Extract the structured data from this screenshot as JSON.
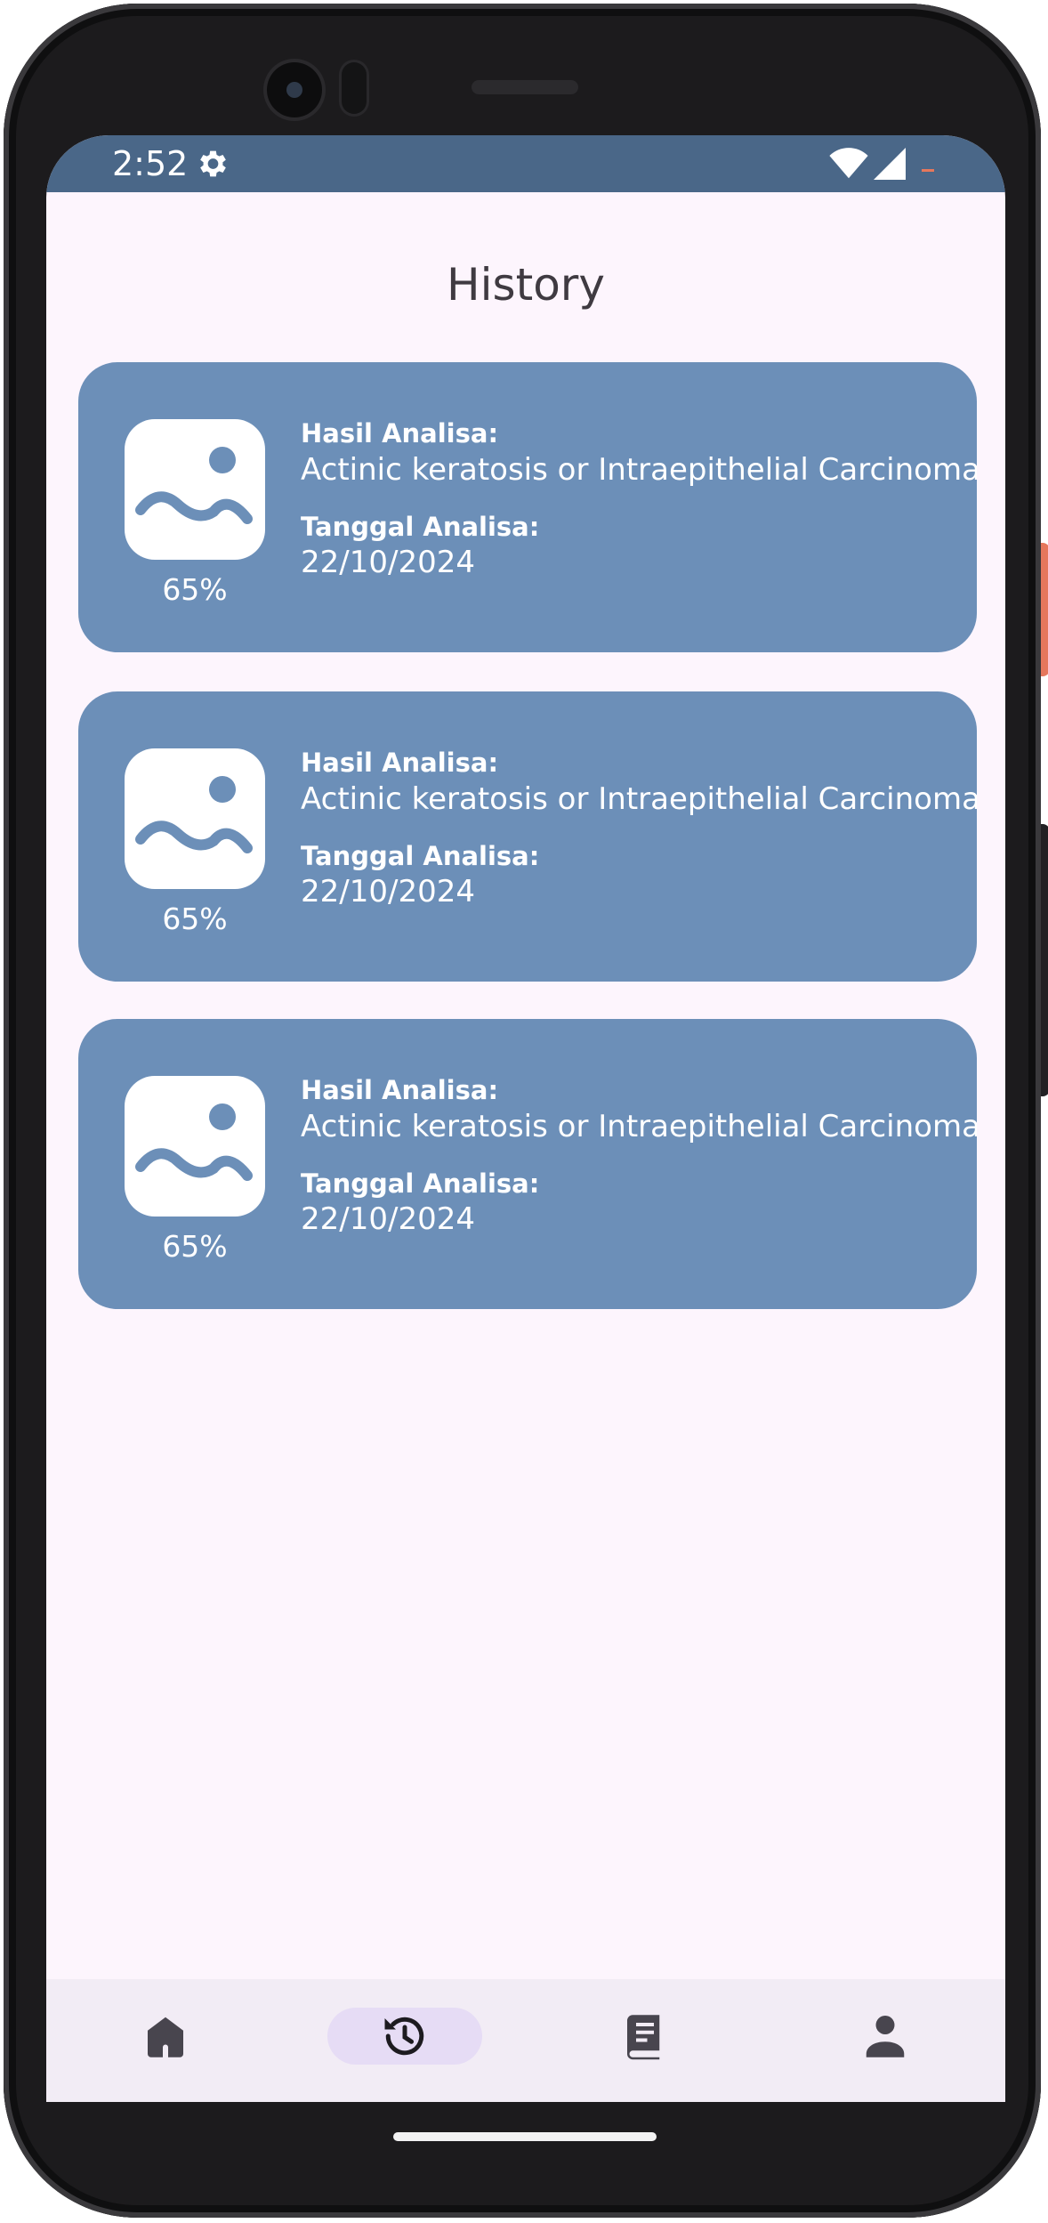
{
  "status_bar": {
    "time": "2:52",
    "icons": [
      "gear-icon",
      "wifi-icon",
      "cell-signal-icon",
      "battery-icon"
    ]
  },
  "page": {
    "title": "History"
  },
  "history": [
    {
      "confidence": "65%",
      "result_label": "Hasil Analisa:",
      "result_value": "Actinic keratosis or Intraepithelial Carcinoma",
      "date_label": "Tanggal Analisa:",
      "date_value": "22/10/2024",
      "thumbnail_icon": "image-placeholder-icon"
    },
    {
      "confidence": "65%",
      "result_label": "Hasil Analisa:",
      "result_value": "Actinic keratosis or Intraepithelial Carcinoma",
      "date_label": "Tanggal Analisa:",
      "date_value": "22/10/2024",
      "thumbnail_icon": "image-placeholder-icon"
    },
    {
      "confidence": "65%",
      "result_label": "Hasil Analisa:",
      "result_value": "Actinic keratosis or Intraepithelial Carcinoma",
      "date_label": "Tanggal Analisa:",
      "date_value": "22/10/2024",
      "thumbnail_icon": "image-placeholder-icon"
    }
  ],
  "bottom_nav": {
    "items": [
      {
        "icon": "home-icon",
        "active": false
      },
      {
        "icon": "history-icon",
        "active": true
      },
      {
        "icon": "book-icon",
        "active": false
      },
      {
        "icon": "person-icon",
        "active": false
      }
    ]
  },
  "colors": {
    "status_bar": "#4a6788",
    "card_background": "#6c8fb8",
    "screen_background": "#fdf5fd",
    "nav_background": "#f2ecf5",
    "nav_active_indicator": "#e6dcf5"
  }
}
